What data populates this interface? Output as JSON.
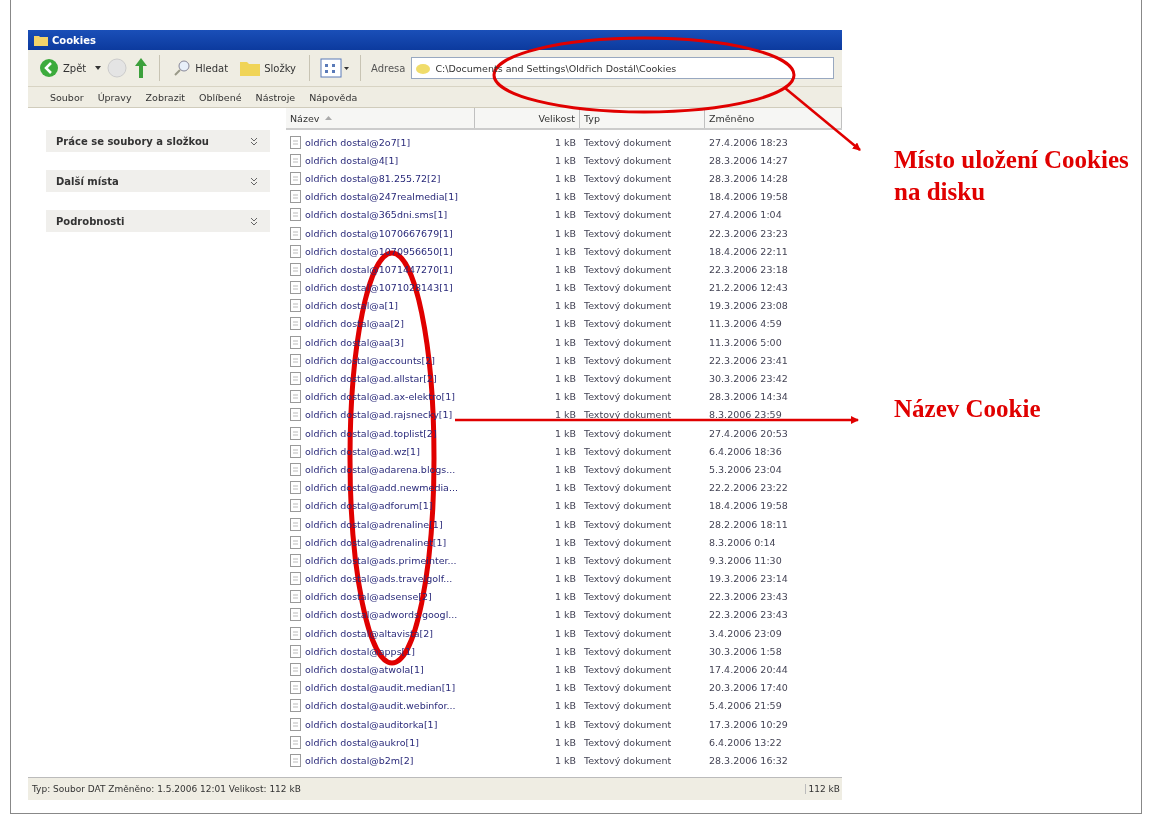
{
  "window": {
    "title": "Cookies"
  },
  "toolbar": {
    "back": "Zpět",
    "search": "Hledat",
    "folders": "Složky",
    "address_label": "Adresa",
    "address": "C:\\Documents and Settings\\Oldřich Dostál\\Cookies"
  },
  "menu": [
    "Soubor",
    "Úpravy",
    "Zobrazit",
    "Oblíbené",
    "Nástroje",
    "Nápověda"
  ],
  "sidebar": {
    "panels": [
      {
        "title": "Práce se soubory a složkou"
      },
      {
        "title": "Další místa"
      },
      {
        "title": "Podrobnosti"
      }
    ]
  },
  "table": {
    "columns": [
      "Název",
      "Velikost",
      "Typ",
      "Změněno"
    ],
    "rows": [
      {
        "name": "oldřich dostal@2o7[1]",
        "size": "1 kB",
        "type": "Textový dokument",
        "modified": "27.4.2006 18:23"
      },
      {
        "name": "oldřich dostal@4[1]",
        "size": "1 kB",
        "type": "Textový dokument",
        "modified": "28.3.2006 14:27"
      },
      {
        "name": "oldřich dostal@81.255.72[2]",
        "size": "1 kB",
        "type": "Textový dokument",
        "modified": "28.3.2006 14:28"
      },
      {
        "name": "oldřich dostal@247realmedia[1]",
        "size": "1 kB",
        "type": "Textový dokument",
        "modified": "18.4.2006 19:58"
      },
      {
        "name": "oldřich dostal@365dni.sms[1]",
        "size": "1 kB",
        "type": "Textový dokument",
        "modified": "27.4.2006 1:04"
      },
      {
        "name": "oldřich dostal@1070667679[1]",
        "size": "1 kB",
        "type": "Textový dokument",
        "modified": "22.3.2006 23:23"
      },
      {
        "name": "oldřich dostal@1070956650[1]",
        "size": "1 kB",
        "type": "Textový dokument",
        "modified": "18.4.2006 22:11"
      },
      {
        "name": "oldřich dostal@1071447270[1]",
        "size": "1 kB",
        "type": "Textový dokument",
        "modified": "22.3.2006 23:18"
      },
      {
        "name": "oldřich dostal@1071028143[1]",
        "size": "1 kB",
        "type": "Textový dokument",
        "modified": "21.2.2006 12:43"
      },
      {
        "name": "oldřich dostal@a[1]",
        "size": "1 kB",
        "type": "Textový dokument",
        "modified": "19.3.2006 23:08"
      },
      {
        "name": "oldřich dostal@aa[2]",
        "size": "1 kB",
        "type": "Textový dokument",
        "modified": "11.3.2006 4:59"
      },
      {
        "name": "oldřich dostal@aa[3]",
        "size": "1 kB",
        "type": "Textový dokument",
        "modified": "11.3.2006 5:00"
      },
      {
        "name": "oldřich dostal@accounts[2]",
        "size": "1 kB",
        "type": "Textový dokument",
        "modified": "22.3.2006 23:41"
      },
      {
        "name": "oldřich dostal@ad.allstar[2]",
        "size": "1 kB",
        "type": "Textový dokument",
        "modified": "30.3.2006 23:42"
      },
      {
        "name": "oldřich dostal@ad.ax-elektro[1]",
        "size": "1 kB",
        "type": "Textový dokument",
        "modified": "28.3.2006 14:34"
      },
      {
        "name": "oldřich dostal@ad.rajsnecky[1]",
        "size": "1 kB",
        "type": "Textový dokument",
        "modified": "8.3.2006 23:59"
      },
      {
        "name": "oldřich dostal@ad.toplist[2]",
        "size": "1 kB",
        "type": "Textový dokument",
        "modified": "27.4.2006 20:53"
      },
      {
        "name": "oldřich dostal@ad.wz[1]",
        "size": "1 kB",
        "type": "Textový dokument",
        "modified": "6.4.2006 18:36"
      },
      {
        "name": "oldřich dostal@adarena.blogs...",
        "size": "1 kB",
        "type": "Textový dokument",
        "modified": "5.3.2006 23:04"
      },
      {
        "name": "oldřich dostal@add.newmedia...",
        "size": "1 kB",
        "type": "Textový dokument",
        "modified": "22.2.2006 23:22"
      },
      {
        "name": "oldřich dostal@adforum[1]",
        "size": "1 kB",
        "type": "Textový dokument",
        "modified": "18.4.2006 19:58"
      },
      {
        "name": "oldřich dostal@adrenaline[1]",
        "size": "1 kB",
        "type": "Textový dokument",
        "modified": "28.2.2006 18:11"
      },
      {
        "name": "oldřich dostal@adrenalinet[1]",
        "size": "1 kB",
        "type": "Textový dokument",
        "modified": "8.3.2006 0:14"
      },
      {
        "name": "oldřich dostal@ads.primeinter...",
        "size": "1 kB",
        "type": "Textový dokument",
        "modified": "9.3.2006 11:30"
      },
      {
        "name": "oldřich dostal@ads.travelgolf...",
        "size": "1 kB",
        "type": "Textový dokument",
        "modified": "19.3.2006 23:14"
      },
      {
        "name": "oldřich dostal@adsense[2]",
        "size": "1 kB",
        "type": "Textový dokument",
        "modified": "22.3.2006 23:43"
      },
      {
        "name": "oldřich dostal@adwords.googl...",
        "size": "1 kB",
        "type": "Textový dokument",
        "modified": "22.3.2006 23:43"
      },
      {
        "name": "oldřich dostal@altavista[2]",
        "size": "1 kB",
        "type": "Textový dokument",
        "modified": "3.4.2006 23:09"
      },
      {
        "name": "oldřich dostal@apps[1]",
        "size": "1 kB",
        "type": "Textový dokument",
        "modified": "30.3.2006 1:58"
      },
      {
        "name": "oldřich dostal@atwola[1]",
        "size": "1 kB",
        "type": "Textový dokument",
        "modified": "17.4.2006 20:44"
      },
      {
        "name": "oldřich dostal@audit.median[1]",
        "size": "1 kB",
        "type": "Textový dokument",
        "modified": "20.3.2006 17:40"
      },
      {
        "name": "oldřich dostal@audit.webinfor...",
        "size": "1 kB",
        "type": "Textový dokument",
        "modified": "5.4.2006 21:59"
      },
      {
        "name": "oldřich dostal@auditorka[1]",
        "size": "1 kB",
        "type": "Textový dokument",
        "modified": "17.3.2006 10:29"
      },
      {
        "name": "oldřich dostal@aukro[1]",
        "size": "1 kB",
        "type": "Textový dokument",
        "modified": "6.4.2006 13:22"
      },
      {
        "name": "oldřich dostal@b2m[2]",
        "size": "1 kB",
        "type": "Textový dokument",
        "modified": "28.3.2006 16:32"
      }
    ]
  },
  "status_bar": {
    "info": "Typ: Soubor DAT Změněno: 1.5.2006 12:01 Velikost: 112 kB",
    "size": "112 kB"
  },
  "annotations": [
    {
      "text": "Místo uložení Cookies na disku"
    },
    {
      "text": "Název Cookie"
    }
  ]
}
